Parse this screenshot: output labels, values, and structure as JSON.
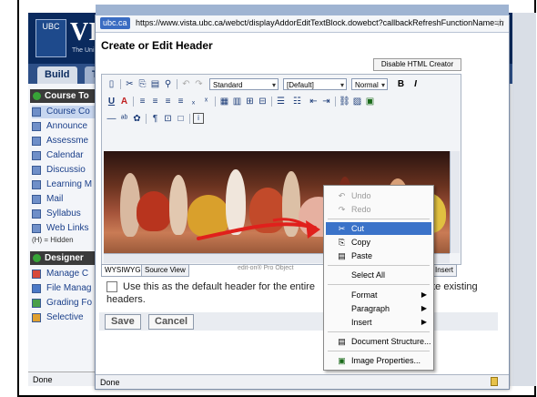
{
  "ubc": {
    "logo_text": "UBC",
    "title": "VI",
    "subtitle": "The Uni"
  },
  "bg_tabs": {
    "build": "Build",
    "t": "T"
  },
  "sidebar": {
    "course_tools_header": "Course To",
    "items": [
      {
        "label": "Course Co"
      },
      {
        "label": "Announce"
      },
      {
        "label": "Assessme"
      },
      {
        "label": "Calendar"
      },
      {
        "label": "Discussio"
      },
      {
        "label": "Learning M"
      },
      {
        "label": "Mail"
      },
      {
        "label": "Syllabus"
      },
      {
        "label": "Web Links"
      }
    ],
    "hidden_note": "(H) = Hidden",
    "designer_header": "Designer",
    "designer_items": [
      {
        "label": "Manage C"
      },
      {
        "label": "File Manag"
      },
      {
        "label": "Grading Fo"
      },
      {
        "label": "Selective"
      }
    ],
    "status": "Done"
  },
  "popup": {
    "address_badge": "ubc.ca",
    "url": "https://www.vista.ubc.ca/webct/displayAddorEditTextBlock.dowebct?callbackRefreshFunctionName=n",
    "dialog_title": "Create or Edit Header",
    "disable_html_btn": "Disable HTML Creator",
    "toolbar": {
      "style_select": "Standard",
      "font_select": "[Default]",
      "size_select": "Normal",
      "bold": "B",
      "italic": "I"
    },
    "mode_tabs": {
      "wysiwyg": "WYSIWYG",
      "source": "Source View",
      "insert": "Insert"
    },
    "mode_note": "edit-on® Pro     Object",
    "default_header_text": "Use this as the default header for the entire",
    "default_header_text2": "rite existing",
    "default_header_line2": "headers.",
    "save_label": "Save",
    "cancel_label": "Cancel",
    "status": "Done"
  },
  "context_menu": {
    "items": [
      {
        "label": "Undo",
        "state": "disabled"
      },
      {
        "label": "Redo",
        "state": "disabled"
      },
      {
        "label": "Cut",
        "state": "highlighted"
      },
      {
        "label": "Copy",
        "state": "normal"
      },
      {
        "label": "Paste",
        "state": "normal"
      },
      {
        "label": "Select All",
        "state": "normal"
      },
      {
        "label": "Format",
        "state": "submenu"
      },
      {
        "label": "Paragraph",
        "state": "submenu"
      },
      {
        "label": "Insert",
        "state": "submenu"
      },
      {
        "label": "Document Structure...",
        "state": "normal"
      },
      {
        "label": "Image Properties...",
        "state": "normal"
      }
    ]
  },
  "colors": {
    "highlight": "#3b73c9",
    "annotation_arrow": "#e0201c",
    "ubc_navy": "#0a2a5e"
  }
}
